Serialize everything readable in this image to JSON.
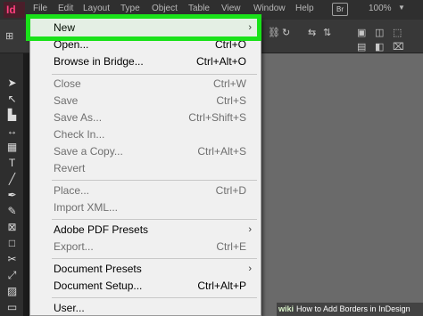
{
  "app": {
    "logo_text": "Id",
    "zoom": "100%"
  },
  "menubar": {
    "items": [
      "File",
      "Edit",
      "Layout",
      "Type",
      "Object",
      "Table",
      "View",
      "Window",
      "Help"
    ],
    "bridge_badge": "Br"
  },
  "file_menu": {
    "items": [
      {
        "label": "New",
        "shortcut": "",
        "submenu": true,
        "enabled": true,
        "highlighted": true
      },
      {
        "label": "Open...",
        "shortcut": "Ctrl+O",
        "enabled": true
      },
      {
        "label": "Browse in Bridge...",
        "shortcut": "Ctrl+Alt+O",
        "enabled": true
      },
      {
        "label": "Close",
        "shortcut": "Ctrl+W",
        "enabled": false
      },
      {
        "label": "Save",
        "shortcut": "Ctrl+S",
        "enabled": false
      },
      {
        "label": "Save As...",
        "shortcut": "Ctrl+Shift+S",
        "enabled": false
      },
      {
        "label": "Check In...",
        "shortcut": "",
        "enabled": false
      },
      {
        "label": "Save a Copy...",
        "shortcut": "Ctrl+Alt+S",
        "enabled": false
      },
      {
        "label": "Revert",
        "shortcut": "",
        "enabled": false
      },
      {
        "label": "Place...",
        "shortcut": "Ctrl+D",
        "enabled": false
      },
      {
        "label": "Import XML...",
        "shortcut": "",
        "enabled": false
      },
      {
        "label": "Adobe PDF Presets",
        "shortcut": "",
        "submenu": true,
        "enabled": true
      },
      {
        "label": "Export...",
        "shortcut": "Ctrl+E",
        "enabled": false
      },
      {
        "label": "Document Presets",
        "shortcut": "",
        "submenu": true,
        "enabled": true
      },
      {
        "label": "Document Setup...",
        "shortcut": "Ctrl+Alt+P",
        "enabled": true
      },
      {
        "label": "User...",
        "shortcut": "",
        "enabled": true
      }
    ]
  },
  "watermark": {
    "logo": "wiki",
    "text": "How to Add Borders in InDesign"
  },
  "colors": {
    "highlight": "#19e219",
    "menu_bg": "#f0f0f0",
    "app_accent": "#ff3f7e"
  }
}
